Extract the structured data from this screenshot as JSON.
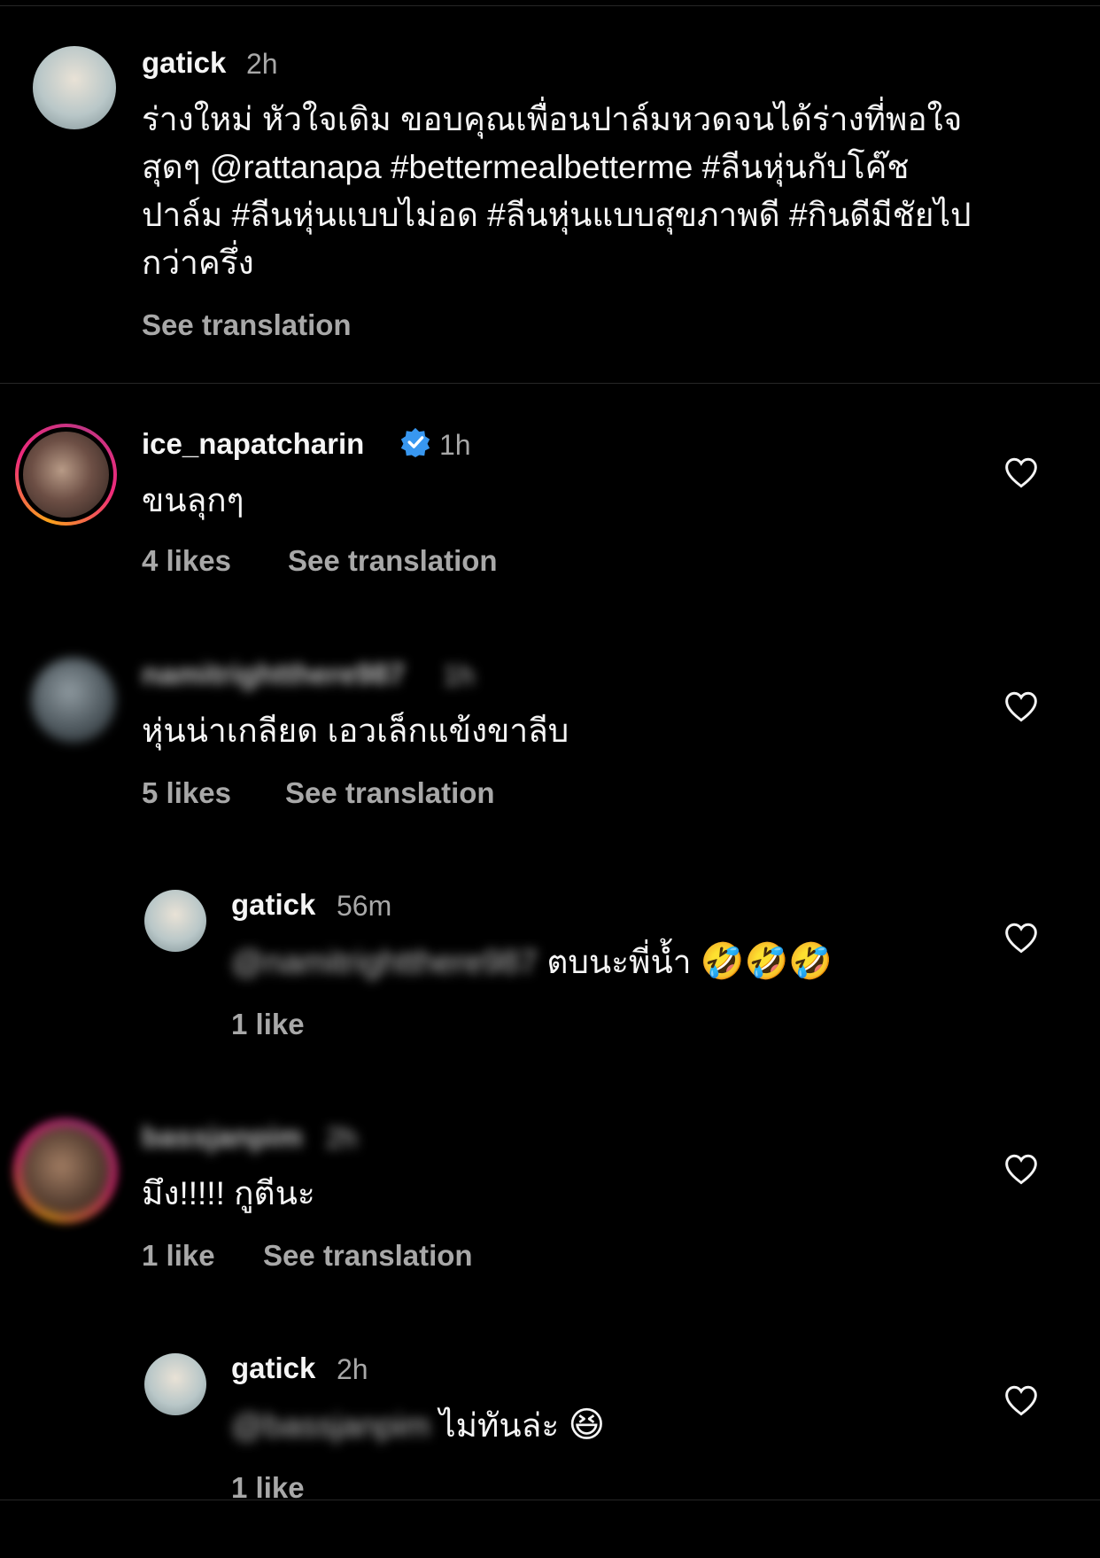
{
  "caption": {
    "username": "gatick",
    "time": "2h",
    "lines": [
      "ร่างใหม่ หัวใจเดิม ขอบคุณเพื่อนปาล์มหวดจนได้ร่างที่พอใจ",
      "สุดๆ @rattanapa  #bettermealbetterme #ลีนหุ่นกับโค๊ช",
      "ปาล์ม #ลีนหุ่นแบบไม่อด #ลีนหุ่นแบบสุขภาพดี #กินดีมีชัยไป",
      "กว่าครึ่ง"
    ],
    "see_translation": "See translation"
  },
  "comments": [
    {
      "username": "ice_napatcharin",
      "verified": true,
      "time": "1h",
      "text": "ขนลุกๆ",
      "likes": "4 likes",
      "see_translation": "See translation"
    },
    {
      "username": "namitrightthere987",
      "time": "1h",
      "text": "หุ่นน่าเกลียด เอวเล็กแข้งขาลีบ",
      "likes": "5 likes",
      "see_translation": "See translation"
    },
    {
      "username": "gatick",
      "time": "56m",
      "mention": "@namitrightthere987",
      "text": "ตบนะพี่น้ำ",
      "emoji": "🤣🤣🤣",
      "likes": "1 like"
    },
    {
      "username": "bassjanpim",
      "time": "2h",
      "text": "มึง!!!!! กูตีนะ",
      "likes": "1 like",
      "see_translation": "See translation"
    },
    {
      "username": "gatick",
      "time": "2h",
      "mention": "@bassjanpim",
      "text": "ไม่ทันล่ะ",
      "emoji": "😆",
      "likes": "1 like"
    }
  ],
  "icons": {
    "like": "heart-outline-icon",
    "verified": "verified-badge-icon"
  },
  "colors": {
    "background": "#000000",
    "primary_text": "#f5f5f5",
    "secondary_text": "#a8a8a8",
    "verified_blue": "#3897f0"
  }
}
